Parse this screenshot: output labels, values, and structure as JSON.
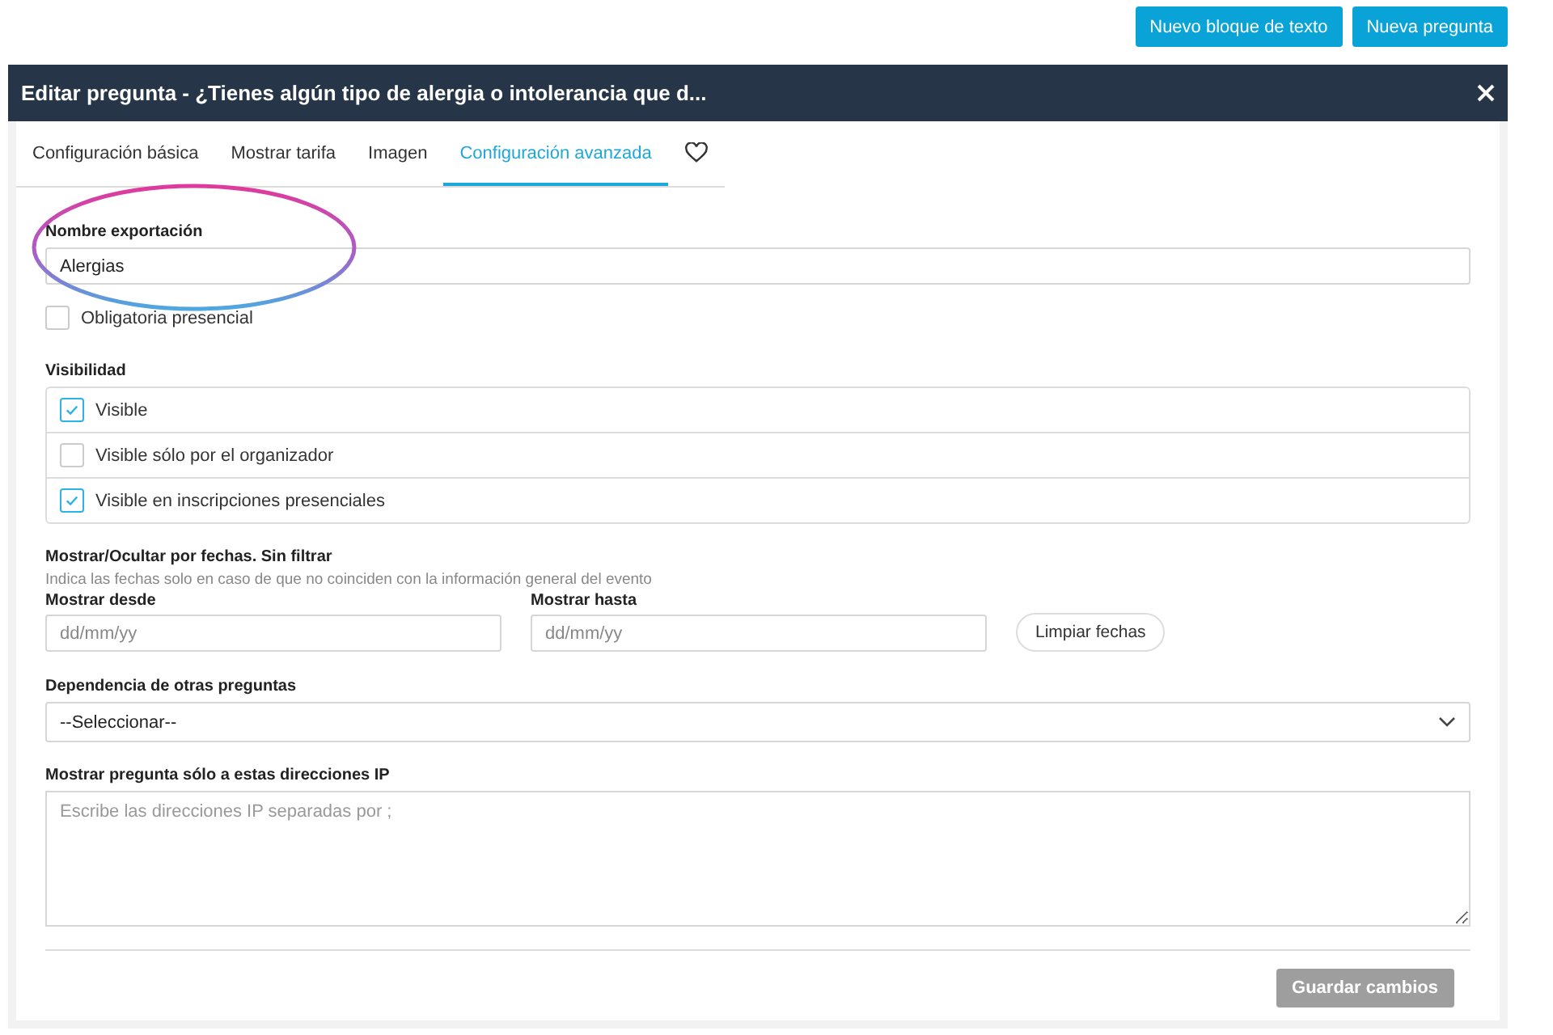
{
  "top_buttons": [
    "Nuevo bloque de texto",
    "Nueva pregunta"
  ],
  "dialog": {
    "title": "Editar pregunta - ¿Tienes algún tipo de alergia o intolerancia que d...",
    "tabs": [
      {
        "kind": "text",
        "label": "Configuración básica",
        "selected": false
      },
      {
        "kind": "text",
        "label": "Mostrar tarifa",
        "selected": false
      },
      {
        "kind": "text",
        "label": "Imagen",
        "selected": false
      },
      {
        "kind": "text",
        "label": "Configuración avanzada",
        "selected": true
      },
      {
        "kind": "heart",
        "selected": false
      }
    ],
    "export_name": {
      "label": "Nombre exportación",
      "value": "Alergias",
      "highlighted": true
    },
    "mandatory": {
      "label": "Obligatoria presencial",
      "checked": false
    },
    "visibility": {
      "label": "Visibilidad",
      "options": [
        {
          "label": "Visible",
          "checked": true
        },
        {
          "label": "Visible sólo por el organizador",
          "checked": false
        },
        {
          "label": "Visible en inscripciones presenciales",
          "checked": true
        }
      ]
    },
    "dates": {
      "title": "Mostrar/Ocultar por fechas. Sin filtrar",
      "hint": "Indica las fechas solo en caso de que no coinciden con la información general del evento",
      "fields": [
        {
          "label": "Mostrar desde",
          "placeholder": "dd/mm/yy"
        },
        {
          "label": "Mostrar hasta",
          "placeholder": "dd/mm/yy"
        }
      ],
      "clear_button": "Limpiar fechas"
    },
    "dependency": {
      "label": "Dependencia de otras preguntas",
      "value": "--Seleccionar--"
    },
    "ip": {
      "label": "Mostrar pregunta sólo a estas direcciones IP",
      "placeholder": "Escribe las direcciones IP separadas por ;"
    },
    "save_button": {
      "label": "Guardar cambios",
      "disabled": true
    }
  }
}
